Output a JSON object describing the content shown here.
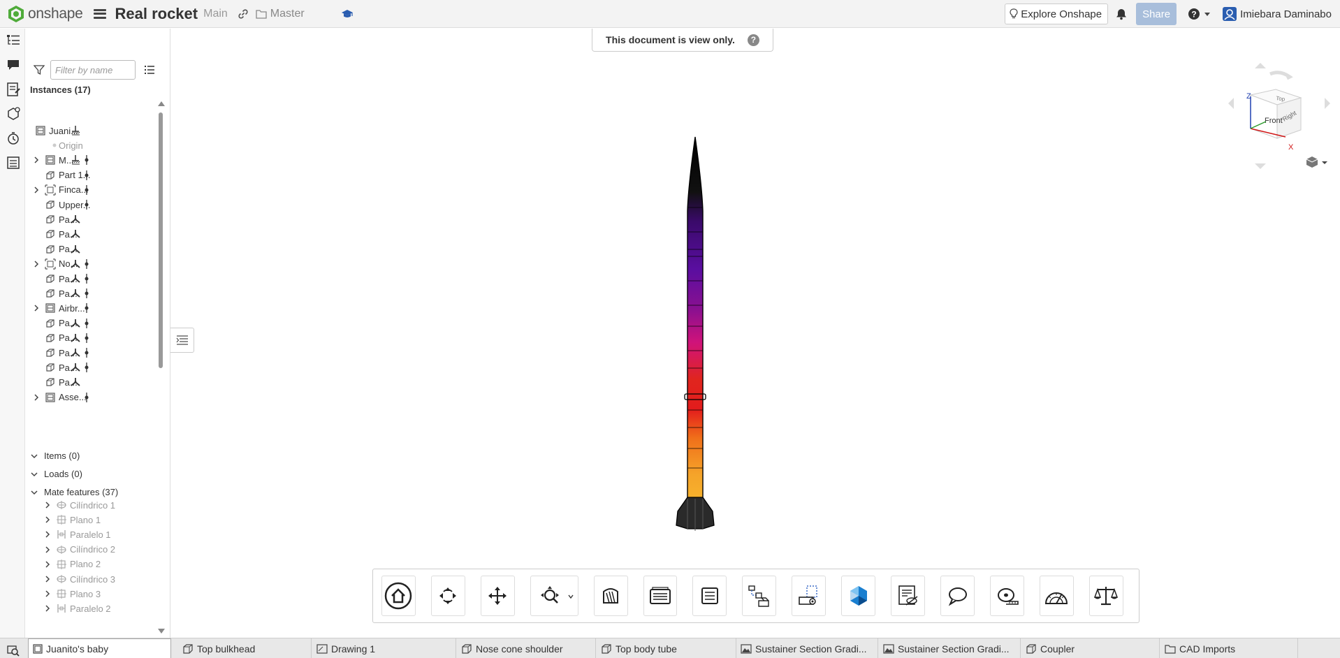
{
  "app": {
    "logo_text": "onshape",
    "doc_title": "Real rocket",
    "branch": "Main",
    "workspace": "Master"
  },
  "header": {
    "explore_label": "Explore Onshape",
    "share_label": "Share",
    "user_name": "Imiebara Daminabo"
  },
  "banner": {
    "text": "This document is view only.",
    "help": "?"
  },
  "panel": {
    "filter_placeholder": "Filter by name",
    "instances_header": "Instances (17)",
    "instances": [
      {
        "label": "Juani...",
        "icon": "assembly-icon",
        "expandable": false,
        "status": "fixed"
      },
      {
        "label": "Origin",
        "icon": "origin-icon",
        "expandable": false,
        "status": "none"
      },
      {
        "label": "M...",
        "icon": "assembly-icon",
        "expandable": true,
        "status": "fixed-mate"
      },
      {
        "label": "Part 1...",
        "icon": "part-icon",
        "expandable": false,
        "status": "mate"
      },
      {
        "label": "Finca...",
        "icon": "group-icon",
        "expandable": true,
        "status": "mate"
      },
      {
        "label": "Upper...",
        "icon": "part-icon",
        "expandable": false,
        "status": "mate"
      },
      {
        "label": "Pa...",
        "icon": "part-icon",
        "expandable": false,
        "status": "free"
      },
      {
        "label": "Pa...",
        "icon": "part-icon",
        "expandable": false,
        "status": "free"
      },
      {
        "label": "Pa...",
        "icon": "part-icon",
        "expandable": false,
        "status": "free"
      },
      {
        "label": "No...",
        "icon": "group-icon",
        "expandable": true,
        "status": "free-mate"
      },
      {
        "label": "Pa...",
        "icon": "part-icon",
        "expandable": false,
        "status": "free-mate"
      },
      {
        "label": "Pa...",
        "icon": "part-icon",
        "expandable": false,
        "status": "free-mate"
      },
      {
        "label": "Airbr...",
        "icon": "assembly-icon",
        "expandable": true,
        "status": "mate"
      },
      {
        "label": "Pa...",
        "icon": "part-icon",
        "expandable": false,
        "status": "free-mate"
      },
      {
        "label": "Pa...",
        "icon": "part-icon",
        "expandable": false,
        "status": "free-mate"
      },
      {
        "label": "Pa...",
        "icon": "part-icon",
        "expandable": false,
        "status": "free-mate"
      },
      {
        "label": "Pa...",
        "icon": "part-icon",
        "expandable": false,
        "status": "free-mate"
      },
      {
        "label": "Pa...",
        "icon": "part-icon",
        "expandable": false,
        "status": "free"
      },
      {
        "label": "Asse...",
        "icon": "assembly-icon",
        "expandable": true,
        "status": "mate"
      }
    ],
    "items_header": "Items (0)",
    "loads_header": "Loads (0)",
    "mates_header": "Mate features (37)",
    "mates": [
      {
        "label": "Cilíndrico 1",
        "icon": "cylindrical-mate-icon"
      },
      {
        "label": "Plano 1",
        "icon": "planar-mate-icon"
      },
      {
        "label": "Paralelo 1",
        "icon": "parallel-mate-icon"
      },
      {
        "label": "Cilíndrico 2",
        "icon": "cylindrical-mate-icon"
      },
      {
        "label": "Plano 2",
        "icon": "planar-mate-icon"
      },
      {
        "label": "Cilíndrico 3",
        "icon": "cylindrical-mate-icon"
      },
      {
        "label": "Plano 3",
        "icon": "planar-mate-icon"
      },
      {
        "label": "Paralelo 2",
        "icon": "parallel-mate-icon"
      }
    ]
  },
  "viewcube": {
    "front": "Front",
    "top": "Top",
    "right": "Right",
    "axis_z": "Z",
    "axis_x": "X"
  },
  "toolbar": {
    "tools": [
      "home-view-icon",
      "rotate-icon",
      "pan-icon",
      "zoom-icon",
      "section-view-icon",
      "named-views-icon",
      "explode-icon",
      "mate-connector-icon",
      "hide-icon",
      "render-icon",
      "insert-icon",
      "comment-icon",
      "measure-icon",
      "angle-icon",
      "mass-properties-icon"
    ]
  },
  "tabs": [
    {
      "label": "Juanito's baby",
      "icon": "assembly-tab-icon",
      "active": true
    },
    {
      "label": "Top bulkhead",
      "icon": "part-studio-tab-icon",
      "active": false
    },
    {
      "label": "Drawing 1",
      "icon": "drawing-tab-icon",
      "active": false
    },
    {
      "label": "Nose cone shoulder",
      "icon": "part-studio-tab-icon",
      "active": false
    },
    {
      "label": "Top body tube",
      "icon": "part-studio-tab-icon",
      "active": false
    },
    {
      "label": "Sustainer Section Gradi...",
      "icon": "image-tab-icon",
      "active": false
    },
    {
      "label": "Sustainer Section Gradi...",
      "icon": "image-tab-icon",
      "active": false
    },
    {
      "label": "Coupler",
      "icon": "part-studio-tab-icon",
      "active": false
    },
    {
      "label": "CAD Imports",
      "icon": "folder-tab-icon",
      "active": false
    }
  ],
  "colors": {
    "brand_green": "#4fab3a",
    "share_disabled": "#a8bedb",
    "rocket_top": "#111111",
    "rocket_purple": "#4b0d8a",
    "rocket_magenta": "#c0127a",
    "rocket_red": "#e01a1a",
    "rocket_orange": "#f07a10",
    "rocket_yellow": "#f5b82a"
  }
}
